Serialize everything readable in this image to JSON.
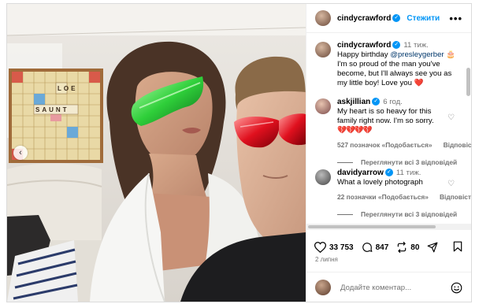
{
  "post": {
    "author": "cindycrawford",
    "follow_label": "Стежити",
    "more_label": "•••"
  },
  "photo": {
    "prev_label": "‹",
    "board_words": [
      "LOE",
      "SAUNT"
    ]
  },
  "comments": [
    {
      "username": "cindycrawford",
      "time": "11 тиж.",
      "text_pre": "Happy birthday ",
      "mention": "@presleygerber",
      "text_post": " 🎂 I'm so proud of the man you've become, but I'll always see you as my little boy! Love you ",
      "emoji": "❤️"
    },
    {
      "username": "askjillian",
      "time": "6 год.",
      "text": "My heart is so heavy for this family right now. I'm so sorry.",
      "emoji": "💔💔💔💔",
      "likes": "527 позначок «Подобається»",
      "reply": "Відповісти",
      "view_replies": "Переглянути всі 3 відповідей"
    },
    {
      "username": "davidyarrow",
      "time": "11 тиж.",
      "text": "What a lovely photograph",
      "likes": "22 позначки «Подобається»",
      "reply": "Відповісти",
      "view_replies": "Переглянути всі 3 відповідей"
    }
  ],
  "actions": {
    "likes": "33 753",
    "comments": "847",
    "reposts": "80"
  },
  "date": "2 липня",
  "add_comment": {
    "placeholder": "Додайте коментар..."
  }
}
